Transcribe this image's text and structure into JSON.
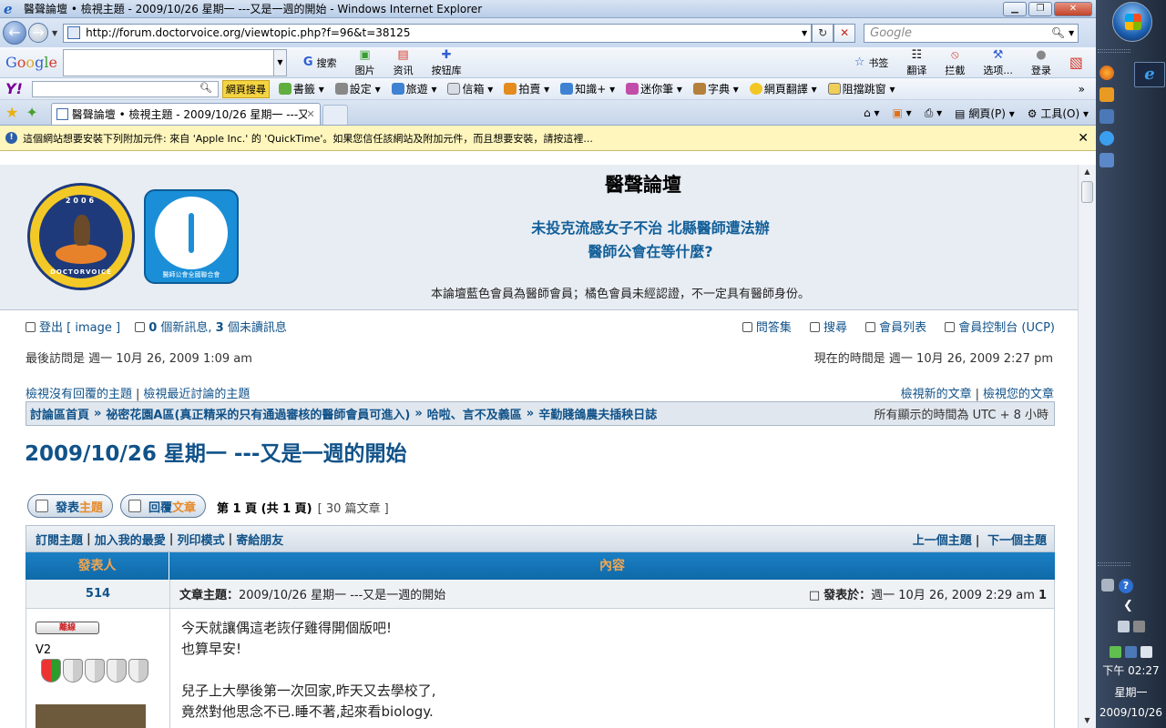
{
  "window": {
    "title": "醫聲論壇 • 檢視主題 - 2009/10/26 星期一 ---又是一週的開始 - Windows Internet Explorer",
    "minimize": "▁",
    "maximize": "❐",
    "close": "✕"
  },
  "address": {
    "url": "http://forum.doctorvoice.org/viewtopic.php?f=96&t=38125",
    "search_placeholder": "Google"
  },
  "google_toolbar": {
    "logo": [
      "G",
      "o",
      "o",
      "g",
      "l",
      "e"
    ],
    "items": [
      "搜索",
      "图片",
      "资讯",
      "按钮库",
      "书签",
      "翻译",
      "拦截",
      "选项...",
      "登录"
    ]
  },
  "yahoo_toolbar": {
    "logo": "Y!",
    "search_button": "網頁搜尋",
    "items": [
      "書籤",
      "設定",
      "旅遊",
      "信箱",
      "拍賣",
      "知識+",
      "迷你筆",
      "字典",
      "網頁翻譯",
      "阻擋跳窗"
    ]
  },
  "tabs": {
    "active": "醫聲論壇 • 檢視主題 - 2009/10/26 星期一 ---又...",
    "close": "✕"
  },
  "command_bar": [
    "網頁(P)",
    "工具(O)"
  ],
  "infobar": {
    "message": "這個網站想要安裝下列附加元件: 來自 'Apple Inc.' 的 'QuickTime'。如果您信任該網站及附加元件，而且想要安裝，請按這裡...",
    "close": "✕"
  },
  "site": {
    "name": "醫聲論壇",
    "slogan_line1": "未投克流感女子不治 北縣醫師遭法辦",
    "slogan_line2": "醫師公會在等什麼?",
    "note": "本論壇藍色會員為醫師會員；橘色會員未經認證，不一定具有醫師身份。",
    "logo1_year": "2006",
    "logo1_name": "DOCTORVOICE",
    "logo2_sub": "醫師公會全國聯合會"
  },
  "menu": {
    "logout": "登出 [ image ]",
    "new_messages_count": "0",
    "new_messages_label": " 個新訊息,",
    "unread_count": "3",
    "unread_label": " 個未讀訊息",
    "faq": "問答集",
    "search": "搜尋",
    "members": "會員列表",
    "ucp": "會員控制台 (UCP)"
  },
  "visit": {
    "last": "最後訪問是 週一 10月 26, 2009 1:09 am",
    "now": "現在的時間是 週一 10月 26, 2009 2:27 pm"
  },
  "quicklinks": {
    "unanswered": "檢視沒有回覆的主題",
    "active": "檢視最近討論的主題",
    "new_posts": "檢視新的文章",
    "your_posts": "檢視您的文章"
  },
  "breadcrumbs": {
    "items": [
      "討論區首頁",
      "祕密花園A區(真正精采的只有通過審核的醫師會員可進入)",
      "哈啦、言不及義區",
      "辛勤賤鴿農夫插秧日誌"
    ],
    "separator": "»",
    "timezone": "所有顯示的時間為 UTC + 8 小時"
  },
  "topic": {
    "title": "2009/10/26 星期一 ---又是一週的開始",
    "post_button_prefix": "發表",
    "post_button_hl": "主題",
    "reply_button_prefix": "回覆",
    "reply_button_hl": "文章",
    "page_info": "第 1 頁 (共 1 頁)",
    "post_count": "[ 30 篇文章 ]"
  },
  "actions": {
    "subscribe": "訂閱主題",
    "bookmark": "加入我的最愛",
    "print": "列印模式",
    "email": "寄給朋友",
    "prev_topic": "上一個主題",
    "next_topic": "下一個主題"
  },
  "table": {
    "col_author": "發表人",
    "col_content": "內容"
  },
  "post": {
    "author": "514",
    "subject_label": "文章主題：",
    "subject": "2009/10/26 星期一 ---又是一週的開始",
    "posted_label": "發表於：",
    "posted": "週一 10月 26, 2009 2:29 am",
    "post_no": "1",
    "status_badge": "離線",
    "rank": "V2",
    "lines": [
      "今天就讓偶這老詼仔雞得開個版吧!",
      "也算早安!",
      "",
      "兒子上大學後第一次回家,昨天又去學校了,",
      "竟然對他思念不已.睡不著,起來看biology."
    ]
  },
  "taskbar": {
    "clock_time": "下午 02:27",
    "clock_day": "星期一",
    "clock_date": "2009/10/26"
  }
}
